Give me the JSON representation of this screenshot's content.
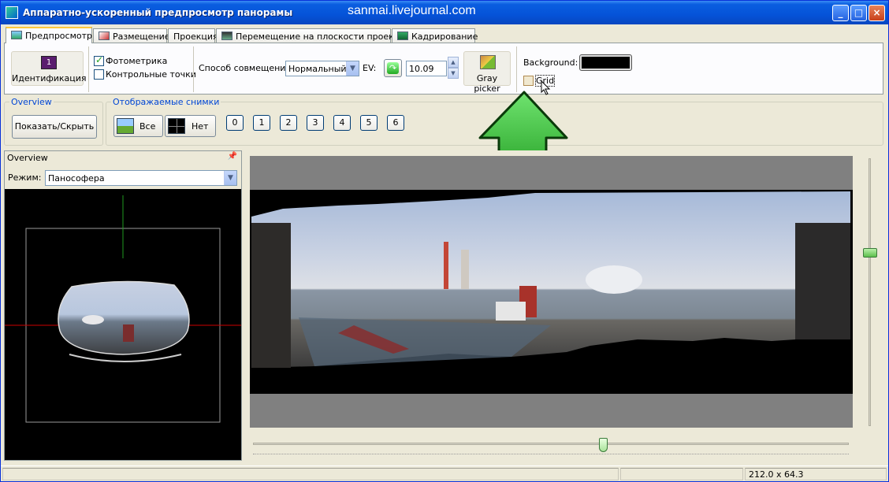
{
  "window": {
    "title": "Аппаратно-ускоренный предпросмотр панорамы",
    "watermark": "sanmai.livejournal.com",
    "controls": [
      "_",
      "□",
      "×"
    ]
  },
  "tabs": [
    {
      "label": "Предпросмотр",
      "active": true
    },
    {
      "label": "Размещение",
      "active": false
    },
    {
      "label": "Проекция",
      "active": false
    },
    {
      "label": "Перемещение на плоскости проекции",
      "active": false
    },
    {
      "label": "Кадрирование",
      "active": false
    }
  ],
  "toolbar": {
    "identify_label": "Идентификация",
    "identify_badge": "1",
    "photometric_label": "Фотометрика",
    "photometric_checked": true,
    "control_points_label": "Контрольные точки",
    "control_points_checked": false,
    "blend_mode_label": "Способ совмещения:",
    "blend_mode_value": "Нормальный",
    "ev_label": "EV:",
    "ev_value": "10.09",
    "gray_picker_label": "Gray picker",
    "background_label": "Background:",
    "background_color": "#000000",
    "grid_label": "Grid",
    "grid_checked": false
  },
  "overview_group": {
    "title": "Overview",
    "toggle_label": "Показать/Скрыть"
  },
  "images_group": {
    "title": "Отображаемые снимки",
    "all_label": "Все",
    "none_label": "Нет",
    "numbers": [
      "0",
      "1",
      "2",
      "3",
      "4",
      "5",
      "6"
    ]
  },
  "overview_pane": {
    "title": "Overview",
    "pin_icon": "pin-icon",
    "mode_label": "Режим:",
    "mode_value": "Панософера"
  },
  "status": {
    "size": "212.0 x 64.3"
  },
  "colors": {
    "titlebar": "#0553d8",
    "accent_arrow": "#2fb52f",
    "tab_active_border": "#ffc83c"
  }
}
